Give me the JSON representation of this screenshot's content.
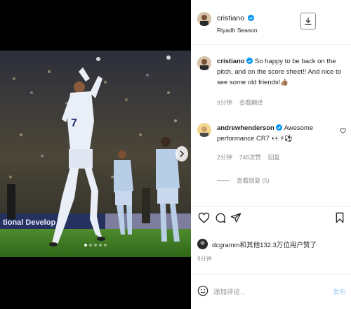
{
  "post": {
    "author": "cristiano",
    "location": "Riyadh Season",
    "photo_banner_text": "tional Develop"
  },
  "caption": {
    "author": "cristiano",
    "text": "So happy to be back on the pitch, and on the score sheet!! And nice to see some old friends!👍🏽",
    "time": "9分钟",
    "translate": "查看翻译"
  },
  "comments": [
    {
      "author": "andrewhenderson",
      "text": "Awesome performance CR7 👀⚡⚽",
      "time": "2分钟",
      "likes": "746次赞",
      "reply": "回复",
      "view_replies": "查看回复 (5)"
    }
  ],
  "likes_text": "dcgramm和其他132.3万位用户赞了",
  "post_time": "9分钟",
  "comment_placeholder": "添加评论...",
  "post_button": "发布",
  "icons": {
    "download": "download-icon",
    "like": "heart-icon",
    "comment": "comment-icon",
    "share": "send-icon",
    "save": "bookmark-icon",
    "emoji": "smiley-icon",
    "next": "chevron-right-icon"
  },
  "colors": {
    "verified": "#0095f6",
    "post_button": "#9fc9f2",
    "secondary_text": "#8e8e8e"
  },
  "carousel": {
    "count": 5,
    "active": 0
  }
}
